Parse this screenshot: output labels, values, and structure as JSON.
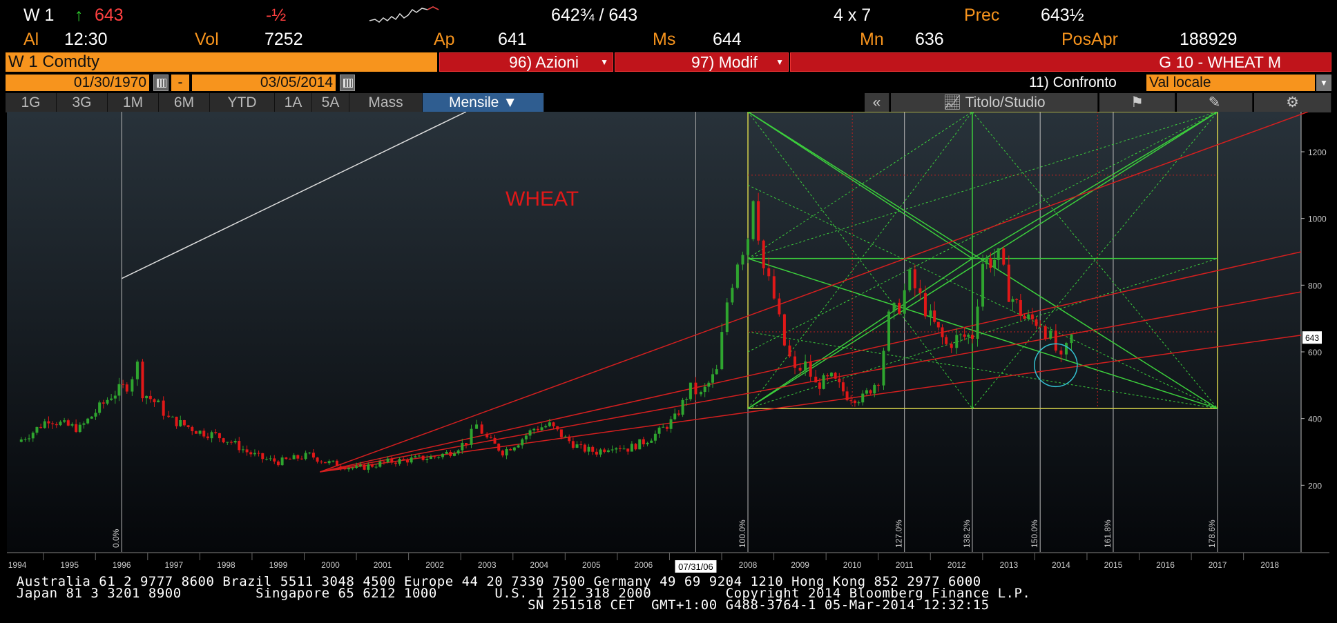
{
  "header": {
    "ticker": "W 1",
    "last_price": "643",
    "change": "-½",
    "bid_ask": "642¾ / 643",
    "size": "4 x 7",
    "prec_label": "Prec",
    "prec_value": "643½",
    "time_label": "Al",
    "time_value": "12:30",
    "vol_label": "Vol",
    "vol_value": "7252",
    "open_label": "Ap",
    "open_value": "641",
    "high_label": "Ms",
    "high_value": "644",
    "low_label": "Mn",
    "low_value": "636",
    "oi_label": "PosApr",
    "oi_value": "188929"
  },
  "toolbar": {
    "security": "W 1 Comdty",
    "actions_label": "96) Azioni",
    "modify_label": "97) Modif",
    "function_title": "G 10 - WHEAT M",
    "start_date": "01/30/1970",
    "date_sep": "-",
    "end_date": "03/05/2014",
    "compare_label": "11) Confronto",
    "currency_value": "Val locale",
    "tabs": [
      "1G",
      "3G",
      "1M",
      "6M",
      "YTD",
      "1A",
      "5A",
      "Mass",
      "Mensile"
    ],
    "collapse_label": "«",
    "study_label": "Titolo/Studio"
  },
  "chart_data": {
    "type": "candlestick",
    "title": "WHEAT",
    "frequency": "Mensile",
    "x_tick_labels": [
      "1994",
      "1995",
      "1996",
      "1997",
      "1998",
      "1999",
      "2000",
      "2001",
      "2002",
      "2003",
      "2004",
      "2005",
      "2006",
      "2007",
      "2008",
      "2009",
      "2010",
      "2011",
      "2012",
      "2013",
      "2014",
      "2015",
      "2016",
      "2017",
      "2018"
    ],
    "x_range": [
      1993.8,
      2018.6
    ],
    "y_ticks": [
      200,
      400,
      600,
      800,
      1000,
      1200
    ],
    "y_range": [
      0,
      1320
    ],
    "last_price_marker": 643,
    "cursor_date": "07/31/06",
    "vertical_markers": [
      {
        "x": 1996.0,
        "label": "0.0%"
      },
      {
        "x": 2008.0,
        "label": "100.0%"
      },
      {
        "x": 2011.0,
        "label": "127.0%"
      },
      {
        "x": 2012.3,
        "label": "138.2%"
      },
      {
        "x": 2013.6,
        "label": "150.0%"
      },
      {
        "x": 2015.0,
        "label": "161.8%"
      },
      {
        "x": 2017.0,
        "label": "178.6%"
      }
    ],
    "extra_vertical_lines": [
      2007.0
    ],
    "price_path": [
      [
        1994.0,
        330
      ],
      [
        1994.3,
        360
      ],
      [
        1994.6,
        400
      ],
      [
        1994.9,
        380
      ],
      [
        1995.2,
        370
      ],
      [
        1995.5,
        420
      ],
      [
        1995.8,
        470
      ],
      [
        1996.1,
        500
      ],
      [
        1996.3,
        560
      ],
      [
        1996.4,
        480
      ],
      [
        1996.7,
        440
      ],
      [
        1996.9,
        400
      ],
      [
        1997.2,
        380
      ],
      [
        1997.5,
        360
      ],
      [
        1997.8,
        350
      ],
      [
        1998.1,
        330
      ],
      [
        1998.4,
        300
      ],
      [
        1998.7,
        280
      ],
      [
        1999.0,
        270
      ],
      [
        1999.3,
        280
      ],
      [
        1999.6,
        290
      ],
      [
        1999.9,
        270
      ],
      [
        2000.2,
        260
      ],
      [
        2000.5,
        250
      ],
      [
        2000.8,
        260
      ],
      [
        2001.1,
        270
      ],
      [
        2001.4,
        275
      ],
      [
        2001.7,
        280
      ],
      [
        2002.0,
        285
      ],
      [
        2002.3,
        300
      ],
      [
        2002.6,
        330
      ],
      [
        2002.8,
        380
      ],
      [
        2003.0,
        340
      ],
      [
        2003.3,
        300
      ],
      [
        2003.6,
        330
      ],
      [
        2003.9,
        370
      ],
      [
        2004.2,
        380
      ],
      [
        2004.5,
        340
      ],
      [
        2004.8,
        310
      ],
      [
        2005.1,
        300
      ],
      [
        2005.4,
        320
      ],
      [
        2005.7,
        310
      ],
      [
        2006.0,
        330
      ],
      [
        2006.3,
        360
      ],
      [
        2006.6,
        400
      ],
      [
        2006.9,
        490
      ],
      [
        2007.1,
        470
      ],
      [
        2007.4,
        540
      ],
      [
        2007.6,
        750
      ],
      [
        2007.8,
        880
      ],
      [
        2008.0,
        950
      ],
      [
        2008.1,
        1080
      ],
      [
        2008.3,
        850
      ],
      [
        2008.5,
        760
      ],
      [
        2008.7,
        620
      ],
      [
        2008.9,
        540
      ],
      [
        2009.1,
        560
      ],
      [
        2009.3,
        500
      ],
      [
        2009.6,
        520
      ],
      [
        2009.9,
        470
      ],
      [
        2010.2,
        460
      ],
      [
        2010.5,
        520
      ],
      [
        2010.7,
        700
      ],
      [
        2010.9,
        740
      ],
      [
        2011.1,
        820
      ],
      [
        2011.3,
        760
      ],
      [
        2011.5,
        700
      ],
      [
        2011.8,
        620
      ],
      [
        2012.0,
        640
      ],
      [
        2012.3,
        650
      ],
      [
        2012.5,
        870
      ],
      [
        2012.8,
        880
      ],
      [
        2013.0,
        780
      ],
      [
        2013.3,
        700
      ],
      [
        2013.6,
        690
      ],
      [
        2013.8,
        640
      ],
      [
        2014.0,
        570
      ],
      [
        2014.2,
        643
      ]
    ]
  }
}
